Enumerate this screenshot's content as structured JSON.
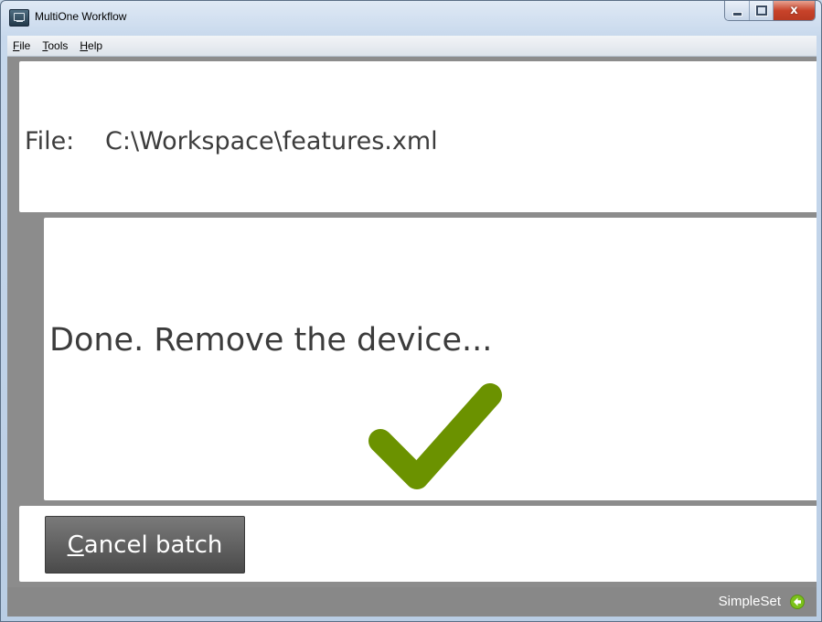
{
  "window": {
    "title": "MultiOne Workflow",
    "controls": {
      "minimize": "minimize",
      "maximize": "maximize",
      "close": "x"
    }
  },
  "menu": [
    {
      "mnemonic": "F",
      "rest": "ile"
    },
    {
      "mnemonic": "T",
      "rest": "ools"
    },
    {
      "mnemonic": "H",
      "rest": "elp"
    }
  ],
  "file_panel": {
    "label": "File:",
    "path": "C:\\Workspace\\features.xml"
  },
  "status_panel": {
    "message": "Done. Remove the device...",
    "icon": "checkmark-icon",
    "icon_color": "#6b9200"
  },
  "actions": {
    "cancel_mnemonic": "C",
    "cancel_rest": "ancel batch"
  },
  "statusbar": {
    "mode_label": "SimpleSet",
    "mode_icon": "arrow-circle-icon",
    "mode_icon_color": "#7cc21a"
  }
}
